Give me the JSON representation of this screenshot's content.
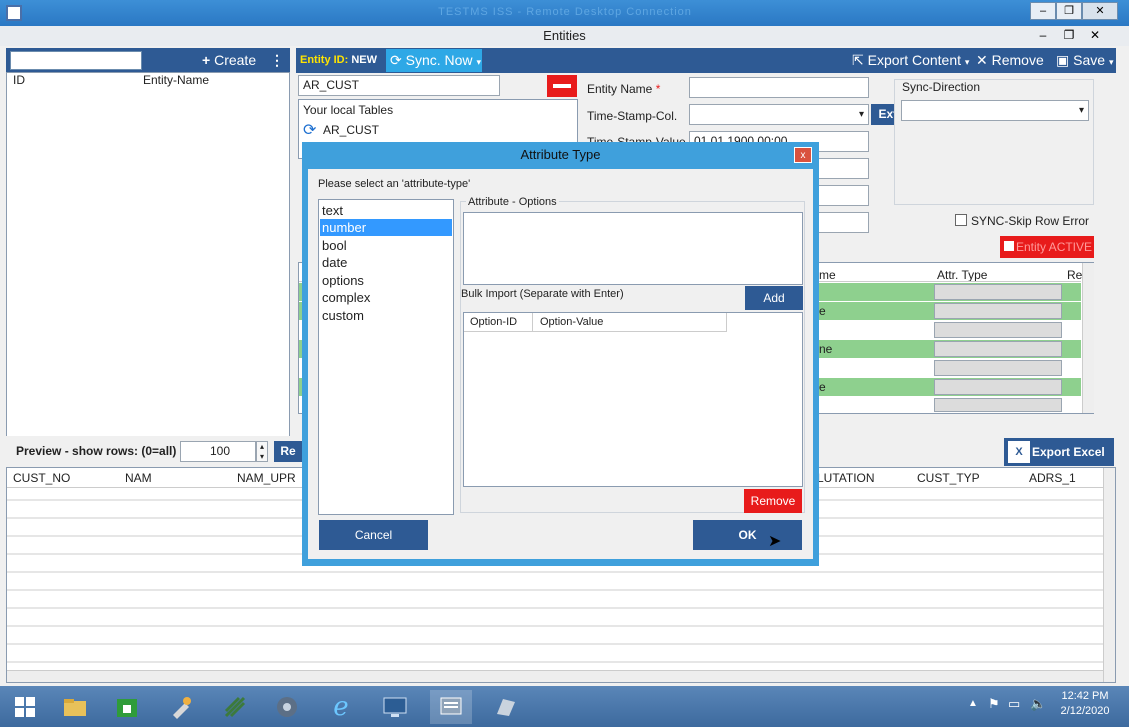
{
  "remote_window": {
    "title": "TESTMS ISS - Remote Desktop Connection"
  },
  "app": {
    "title": "Entities",
    "sidebar": {
      "create_label": "Create",
      "columns": [
        "ID",
        "Entity-Name"
      ]
    },
    "toolbar": {
      "entity_id_label": "Entity ID:",
      "entity_id_value": "NEW",
      "sync_label": "Sync. Now",
      "export_label": "Export Content",
      "remove_label": "Remove",
      "save_label": "Save"
    },
    "table_input": "AR_CUST",
    "local_tables": {
      "header": "Your local Tables",
      "items": [
        "AR_CUST"
      ]
    },
    "form": {
      "entity_name_label": "Entity Name",
      "required_mark": "*",
      "timestamp_col_label": "Time-Stamp-Col.",
      "timestamp_value_label": "Time-Stamp-Value",
      "timestamp_value": "01.01.1900 00:00",
      "ext_label": "Ext.",
      "sync_direction_label": "Sync-Direction",
      "skip_error_label": "SYNC-Skip Row Error",
      "entity_active_label": "Entity ACTIVE"
    },
    "attr_grid": {
      "columns": [
        "me",
        "Attr. Type",
        "Re"
      ],
      "row_frags": [
        "",
        "e",
        "",
        "ne",
        "",
        "e",
        ""
      ]
    },
    "preview": {
      "label": "Preview - show rows: (0=all)",
      "rows_value": "100",
      "refresh_label": "Re",
      "export_excel_label": "Export Excel",
      "columns": [
        "CUST_NO",
        "NAM",
        "NAM_UPR",
        "LUTATION",
        "CUST_TYP",
        "ADRS_1"
      ]
    }
  },
  "dialog": {
    "title": "Attribute Type",
    "close": "x",
    "prompt": "Please select an 'attribute-type'",
    "types": [
      "text",
      "number",
      "bool",
      "date",
      "options",
      "complex",
      "custom"
    ],
    "selected_type": "number",
    "options_group": "Attribute - Options",
    "bulk_label": "Bulk Import (Separate with Enter)",
    "add_label": "Add",
    "option_columns": [
      "Option-ID",
      "Option-Value"
    ],
    "remove_label": "Remove",
    "cancel_label": "Cancel",
    "ok_label": "OK"
  },
  "taskbar": {
    "time": "12:42 PM",
    "date": "2/12/2020",
    "icons": [
      "start-icon",
      "file-explorer-icon",
      "store-icon",
      "tools-icon",
      "network-icon",
      "settings-gear-icon",
      "internet-explorer-icon",
      "remote-desktop-icon",
      "server-manager-icon",
      "notes-icon"
    ]
  },
  "colors": {
    "accent": "#2e5a94",
    "sync": "#2ea8e6",
    "selection": "#3399ff",
    "danger": "#e81b1b",
    "row_green": "#8ed08e"
  }
}
